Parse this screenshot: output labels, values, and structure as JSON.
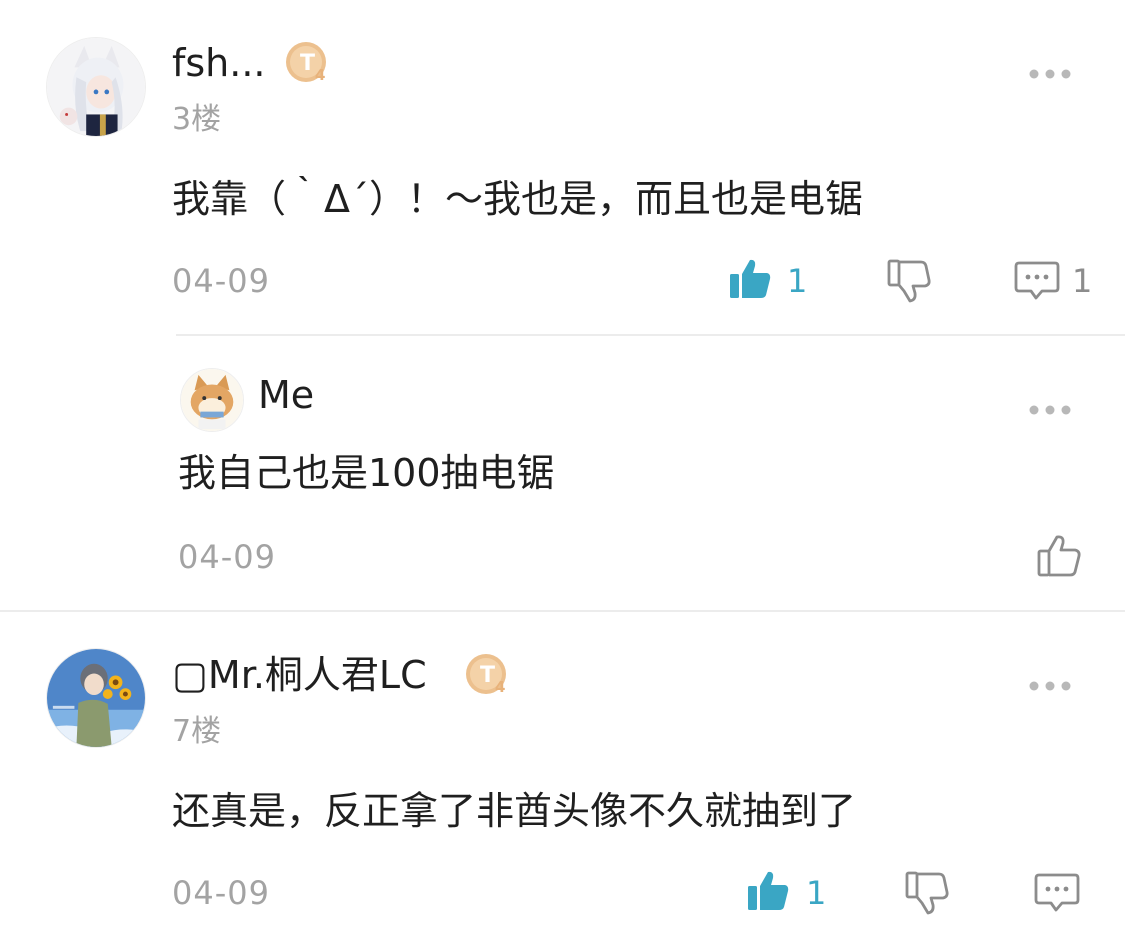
{
  "colors": {
    "accent": "#3aa6c4",
    "muted": "#a3a3a3",
    "text": "#1f1f1f",
    "divider": "#ececec"
  },
  "comments": [
    {
      "username": "fsh...",
      "badge_letter": "T",
      "badge_level": "4",
      "floor": "3楼",
      "content": "我靠（｀Δ´）！～我也是，而且也是电锯",
      "date": "04-09",
      "likes": "1",
      "replies": "1",
      "liked": true,
      "reply": {
        "username": "Me",
        "content": "我自己也是100抽电锯",
        "date": "04-09"
      }
    },
    {
      "username": "▢Mr.桐人君LC",
      "badge_letter": "T",
      "badge_level": "4",
      "floor": "7楼",
      "content": "还真是，反正拿了非酋头像不久就抽到了",
      "date": "04-09",
      "likes": "1",
      "liked": true
    }
  ],
  "icons": {
    "more": "more-dots-icon",
    "like": "thumbs-up-icon",
    "dislike": "thumbs-down-icon",
    "reply": "comment-bubble-icon",
    "like_outline": "thumbs-up-outline-icon"
  }
}
